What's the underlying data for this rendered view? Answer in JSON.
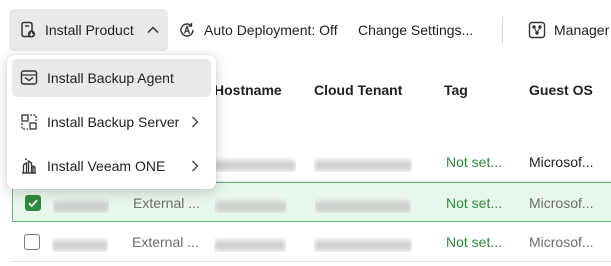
{
  "toolbar": {
    "install_product": "Install Product",
    "auto_deployment": "Auto Deployment: Off",
    "change_settings": "Change Settings...",
    "manager": "Manager"
  },
  "install_menu": {
    "items": [
      {
        "label": "Install Backup Agent",
        "icon": "backup-agent-icon",
        "has_submenu": false
      },
      {
        "label": "Install Backup Server",
        "icon": "backup-server-icon",
        "has_submenu": true
      },
      {
        "label": "Install Veeam ONE",
        "icon": "veeam-one-icon",
        "has_submenu": true
      }
    ]
  },
  "table": {
    "columns": [
      "Hostname",
      "Cloud Tenant",
      "Tag",
      "Guest OS"
    ],
    "rows": [
      {
        "selected": false,
        "type": "",
        "tag": "Not set...",
        "guest_os": "Microsof..."
      },
      {
        "selected": true,
        "type": "External ...",
        "tag": "Not set...",
        "guest_os": "Microsof..."
      },
      {
        "selected": false,
        "type": "External ...",
        "tag": "Not set...",
        "guest_os": "Microsof..."
      }
    ]
  },
  "colors": {
    "accent_green": "#2e8b3e",
    "selected_row_bg": "#e9f6ec",
    "toolbar_active_bg": "#e9e9e9"
  }
}
